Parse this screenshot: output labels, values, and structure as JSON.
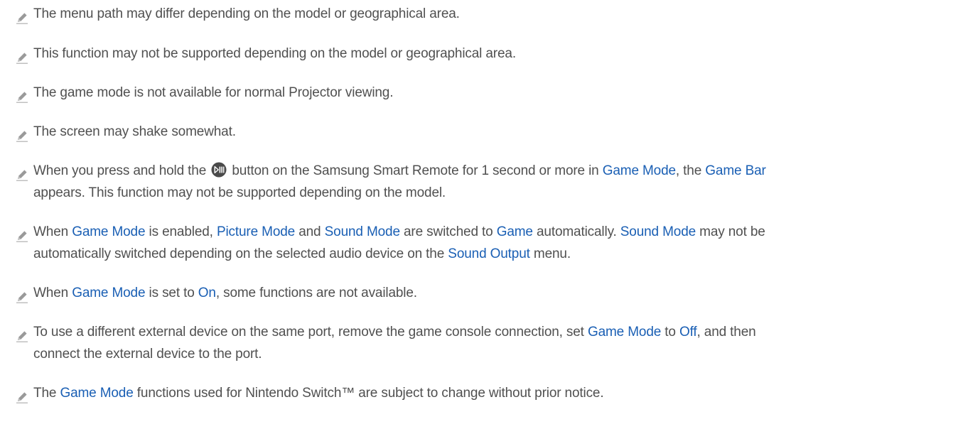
{
  "colors": {
    "body_text": "#505050",
    "keyword": "#1a5fb4",
    "icon": "#8a8a8a"
  },
  "icons": {
    "note": "pencil-icon",
    "remote_button": "play-pause-button-icon"
  },
  "notes": [
    {
      "text": "The menu path may differ depending on the model or geographical area."
    },
    {
      "text": "This function may not be supported depending on the model or geographical area."
    },
    {
      "text": "The game mode is not available for normal Projector viewing."
    },
    {
      "text": "The screen may shake somewhat."
    },
    {
      "line1": {
        "a": "When you press and hold the",
        "b": "button on the Samsung Smart Remote for 1 second or more in",
        "kw1": "Game Mode",
        "c": ", the",
        "kw2": "Game Bar"
      },
      "line2": "appears. This function may not be supported depending on the model."
    },
    {
      "line1": {
        "a": "When",
        "kw1": "Game Mode",
        "b": "is enabled,",
        "kw2": "Picture Mode",
        "c": "and",
        "kw3": "Sound Mode",
        "d": "are switched to",
        "kw4": "Game",
        "e": "automatically.",
        "kw5": "Sound Mode",
        "f": "may not be"
      },
      "line2": {
        "a": "automatically switched depending on the selected audio device on the",
        "kw1": "Sound Output",
        "b": "menu."
      }
    },
    {
      "a": "When",
      "kw1": "Game Mode",
      "b": "is set to",
      "kw2": "On",
      "c": ", some functions are not available."
    },
    {
      "line1": {
        "a": "To use a different external device on the same port, remove the game console connection, set",
        "kw1": "Game Mode",
        "b": "to",
        "kw2": "Off",
        "c": ", and then"
      },
      "line2": "connect the external device to the port."
    },
    {
      "a": "The",
      "kw1": "Game Mode",
      "b": "functions used for Nintendo Switch™ are subject to change without prior notice."
    }
  ]
}
